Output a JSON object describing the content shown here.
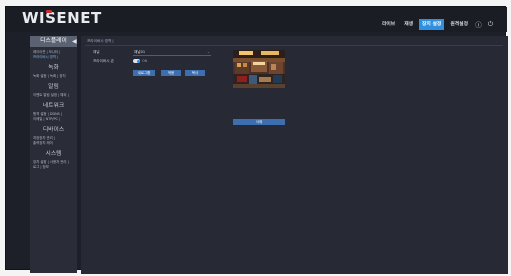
{
  "brand": {
    "logo_text": "WISENET",
    "accent_color": "#d12b2b"
  },
  "topnav": {
    "items": [
      {
        "label": "라이브",
        "active": false
      },
      {
        "label": "재생",
        "active": false
      },
      {
        "label": "장치 설정",
        "active": true
      },
      {
        "label": "원격설정",
        "active": false
      }
    ],
    "icons": {
      "help": "ⓘ",
      "power": "⏻"
    },
    "active_color": "#2f8fe0"
  },
  "sidebar": {
    "sections": [
      {
        "title": "디스플레이",
        "subs": [
          "레이아웃 | 모니터 |",
          "프라이버시 영역 |"
        ]
      },
      {
        "title": "녹화",
        "subs": [
          "녹화 설정 | 녹화 | 장치"
        ]
      },
      {
        "title": "알림",
        "subs": [
          "이벤트 알림 설정 | 예외 |"
        ]
      },
      {
        "title": "네트워크",
        "subs": [
          "원격 설정 | DDNS |",
          "이메일 | NTP/PC |"
        ]
      },
      {
        "title": "디바이스",
        "subs": [
          "저장장치 관리 |",
          "출력장치 제어"
        ]
      },
      {
        "title": "시스템",
        "subs": [
          "장치 설정 | 사용자 관리 |",
          "로그 | 정보"
        ]
      }
    ],
    "collapse_icon": "◀"
  },
  "content": {
    "page_tab": "프라이버시 영역 |",
    "channel_label": "채널",
    "channel_value": "채널01",
    "privacy_label": "프라이버시 존",
    "privacy_toggle_text": "ON",
    "buttons": {
      "add": "새로그룹",
      "apply": "적용",
      "cancel": "복사"
    },
    "delete_button": "삭제"
  }
}
